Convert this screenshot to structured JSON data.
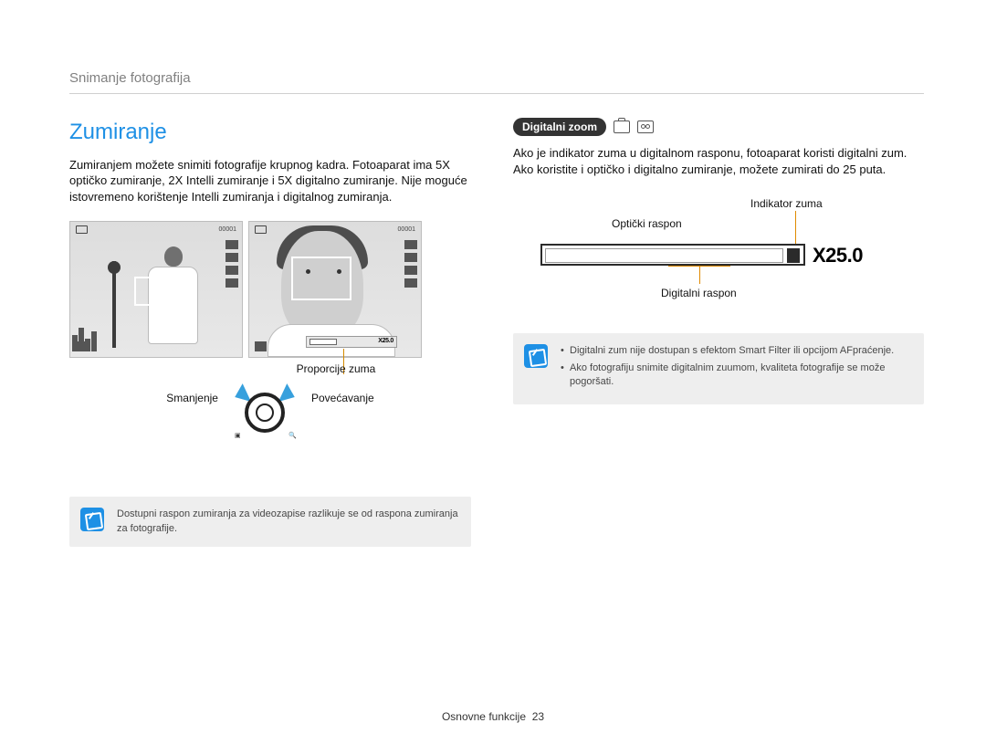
{
  "breadcrumb": "Snimanje fotografija",
  "h1": "Zumiranje",
  "intro": "Zumiranjem možete snimiti fotografije krupnog kadra. Fotoaparat ima 5X optičko zumiranje, 2X Intelli zumiranje i 5X digitalno zumiranje. Nije moguće istovremeno korištenje Intelli zumiranja i digitalnog zumiranja.",
  "shots": {
    "counter": "00001",
    "zoom_overlay": "X25.0"
  },
  "labels": {
    "proportions": "Proporcije zuma",
    "decrease": "Smanjenje",
    "increase": "Povećavanje"
  },
  "note_left": "Dostupni raspon zumiranja za videozapise razlikuje se od raspona zumiranja za fotografije.",
  "digital": {
    "pill": "Digitalni zoom",
    "intro": "Ako je indikator zuma u digitalnom rasponu, fotoaparat koristi digitalni zum. Ako koristite i optičko i digitalno zumiranje, možete zumirati do 25 puta.",
    "label_indicator": "Indikator zuma",
    "label_optical": "Optički raspon",
    "label_digital": "Digitalni raspon",
    "x_value": "X25.0"
  },
  "note_right": [
    "Digitalni zum nije dostupan s efektom Smart Filter ili opcijom AFpraćenje.",
    "Ako fotografiju snimite digitalnim zuumom, kvaliteta fotografije se može pogoršati."
  ],
  "footer": {
    "section": "Osnovne funkcije",
    "page": "23"
  }
}
